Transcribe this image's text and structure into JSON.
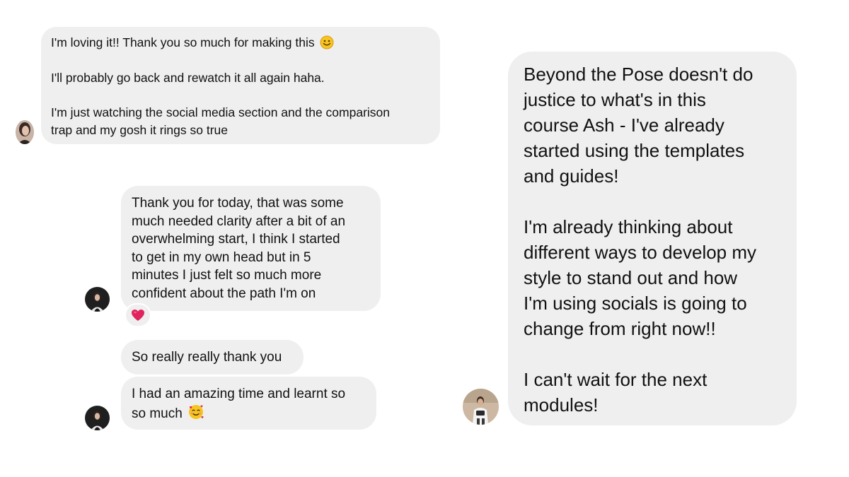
{
  "conversations": {
    "msg1": {
      "para1": "I'm loving it!! Thank you so much for making this",
      "para1_emoji": "smiling-face-emoji",
      "para2": "I'll probably go back and rewatch it all again haha.",
      "para3_line1": "I'm just watching the social media section and the comparison",
      "para3_line2": "trap and my gosh it rings so true"
    },
    "msg2": {
      "lines": [
        "Thank you for today, that was some",
        "much needed clarity after a bit of an",
        "overwhelming start, I think I started",
        "to get in my own head but in 5",
        "minutes I just felt so much more",
        "confident about the path I'm on"
      ],
      "reaction": "heart-emoji"
    },
    "msg3": {
      "text": "So really really thank you"
    },
    "msg4": {
      "line1": "I had an amazing time and learnt so",
      "line2": "so much",
      "line2_emoji": "smiling-face-with-hearts-emoji"
    },
    "msg5": {
      "lines_p1": [
        "Beyond the Pose doesn't do",
        "justice to what's in this",
        "course Ash - I've already",
        "started using the templates",
        "and guides!"
      ],
      "lines_p2": [
        "I'm already thinking about",
        "different ways to develop my",
        "style to stand out and how",
        "I'm using socials is going to",
        "change from right now!!"
      ],
      "lines_p3": [
        "I can't wait for the next",
        "modules!"
      ]
    }
  },
  "colors": {
    "bubble": "#efefef",
    "text": "#111111",
    "background": "#ffffff",
    "heart": "#e0245e"
  }
}
